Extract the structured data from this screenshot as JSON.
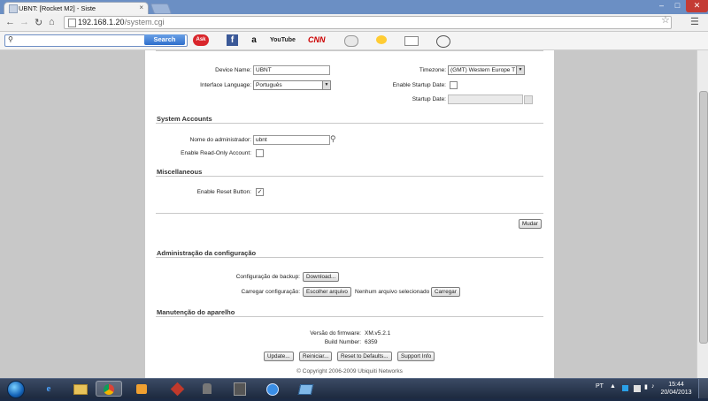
{
  "browser": {
    "tab_title": "UBNT: [Rocket M2] - Siste",
    "tab_close": "×",
    "address_host": "192.168.1.20",
    "address_path": "/system.cgi",
    "window_minimize": "–",
    "window_maximize": "□",
    "window_close": "✕"
  },
  "addon_bar": {
    "search_placeholder": "",
    "search_button": "Search",
    "ask_label": "Ask",
    "facebook_label": "f",
    "amazon_label": "a",
    "youtube_label": "YouTube",
    "cnn_label": "CNN"
  },
  "device": {
    "device_name_label": "Device Name:",
    "device_name_value": "UBNT",
    "interface_language_label": "Interface Language:",
    "interface_language_value": "Português",
    "timezone_label": "Timezone:",
    "timezone_value": "(GMT) Western Europe T",
    "enable_startup_date_label": "Enable Startup Date:",
    "startup_date_label": "Startup Date:",
    "startup_date_value": ""
  },
  "system_accounts": {
    "title": "System Accounts",
    "admin_name_label": "Nome do administrador:",
    "admin_name_value": "ubnt",
    "readonly_label": "Enable Read-Only Account:",
    "readonly_checked": false
  },
  "misc": {
    "title": "Miscellaneous",
    "reset_button_label": "Enable Reset Button:",
    "reset_button_checked": true,
    "reset_check_mark": "✓"
  },
  "actions": {
    "change_button": "Mudar"
  },
  "config_admin": {
    "title": "Administração da configuração",
    "backup_label": "Configuração de backup:",
    "download_button": "Download...",
    "upload_label": "Carregar configuração:",
    "choose_file_button": "Escolher arquivo",
    "no_file_text": "Nenhum arquivo selecionado",
    "upload_button": "Carregar"
  },
  "maintenance": {
    "title": "Manutenção do aparelho",
    "firmware_label": "Versão do firmware:",
    "firmware_value": "XM.v5.2.1",
    "build_label": "Build Number:",
    "build_value": "6359",
    "update_button": "Update...",
    "reboot_button": "Reiniciar...",
    "reset_defaults_button": "Reset to Defaults...",
    "support_button": "Support Info"
  },
  "footer": {
    "copyright": "© Copyright 2006-2009 Ubiquiti Networks"
  },
  "taskbar": {
    "language": "PT",
    "time": "15:44",
    "date": "20/04/2013"
  }
}
